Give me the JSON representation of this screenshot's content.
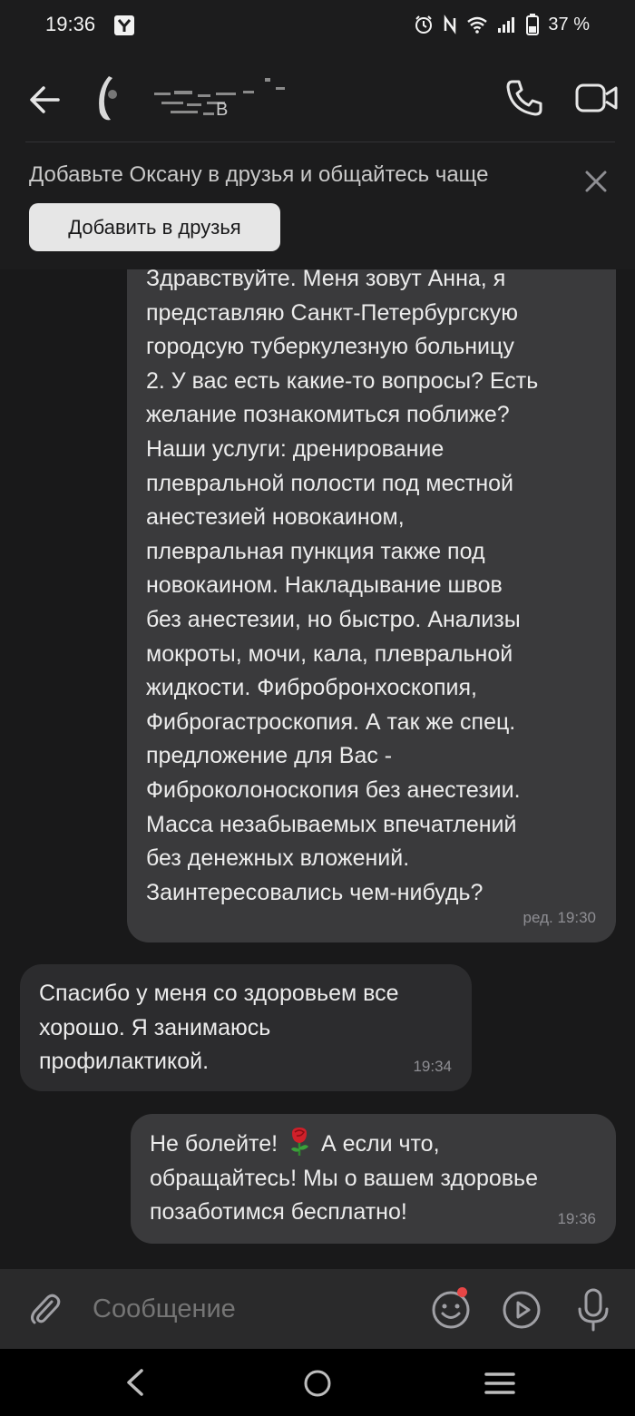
{
  "status_bar": {
    "time": "19:36",
    "battery_percent": "37 %",
    "icons": [
      "app-notification-icon",
      "alarm-icon",
      "nfc-icon",
      "wifi-icon",
      "signal-icon",
      "battery-icon"
    ]
  },
  "header": {
    "contact_name_visible_fragment": "В",
    "back_icon": "arrow-left-icon",
    "call_icon": "phone-icon",
    "video_icon": "video-camera-icon"
  },
  "friend_banner": {
    "text": "Добавьте Оксану в друзья и общайтесь чаще",
    "button_label": "Добавить в друзья"
  },
  "messages": [
    {
      "direction": "outgoing",
      "text": "Здравствуйте. Меня зовут Анна, я\nпредставляю Санкт-Петербургскую\nгородсую туберкулезную больницу\n2. У вас есть какие-то вопросы? Есть\nжелание познакомиться поближе?\nНаши услуги: дренирование\nплевральной полости под местной\nанестезией новокаином,\nплевральная пункция также под\nновокаином. Накладывание швов\nбез анестезии, но быстро. Анализы\nмокроты, мочи, кала, плевральной\nжидкости. Фибробронхоскопия,\nФиброгастроскопия. А так же спец.\nпредложение для Вас -\nФиброколоноскопия без анестезии.\nМасса незабываемых впечатлений\nбез денежных вложений.\nЗаинтересовались чем-нибудь?",
      "time": "ред. 19:30"
    },
    {
      "direction": "incoming",
      "text": "Спасибо у меня со здоровьем все\nхорошо. Я занимаюсь\nпрофилактикой.",
      "time": "19:34"
    },
    {
      "direction": "outgoing",
      "text_before_emoji": "Не болейте!",
      "emoji": "rose-emoji",
      "text_after_emoji": "А если что,",
      "text_rest": "обращайтесь! Мы о вашем здоровье\nпозаботимся бесплатно!",
      "time": "19:36"
    }
  ],
  "input_bar": {
    "placeholder": "Сообщение",
    "icons": [
      "paperclip-icon",
      "emoji-icon",
      "video-message-icon",
      "microphone-icon"
    ]
  },
  "colors": {
    "background": "#1c1c1d",
    "outgoing_bubble": "#3a3a3c",
    "incoming_bubble": "#2c2c2e",
    "button_light": "#e6e6e6",
    "notification_dot": "#e64646"
  }
}
